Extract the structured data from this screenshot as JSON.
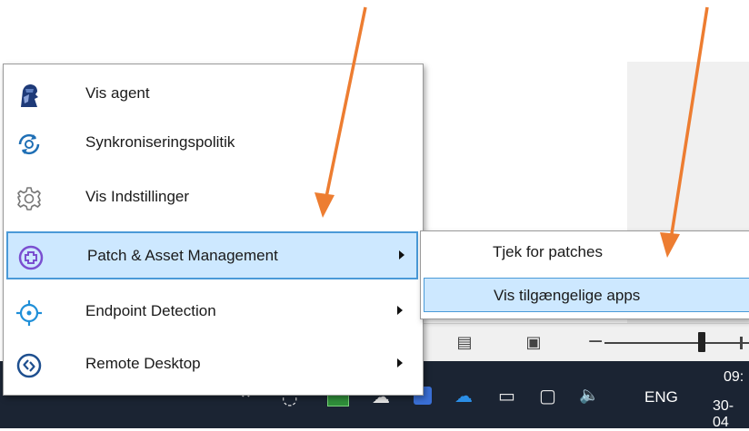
{
  "menu": {
    "items": [
      {
        "label": "Vis agent",
        "icon": "agent-icon"
      },
      {
        "label": "Synkroniseringspolitik",
        "icon": "sync-icon"
      },
      {
        "label": "Vis Indstillinger",
        "icon": "gear-icon"
      },
      {
        "label": "Patch & Asset Management",
        "icon": "plus-circle-icon",
        "submenu": true,
        "selected": true
      },
      {
        "label": "Endpoint Detection",
        "icon": "target-icon",
        "submenu": true
      },
      {
        "label": "Remote Desktop",
        "icon": "remote-desktop-icon",
        "submenu": true
      }
    ]
  },
  "submenu": {
    "items": [
      {
        "label": "Tjek for patches"
      },
      {
        "label": "Vis tilgængelige apps",
        "selected": true
      }
    ]
  },
  "taskbar": {
    "language": "ENG",
    "time": "09:",
    "date": "30-04"
  },
  "colors": {
    "accent": "#4a9ad8",
    "selection": "#cde8ff",
    "annotation_arrow": "#ed7d31",
    "taskbar": "#1b2433",
    "icon_blue": "#1f6fb5",
    "icon_purple": "#7a4fd0"
  }
}
